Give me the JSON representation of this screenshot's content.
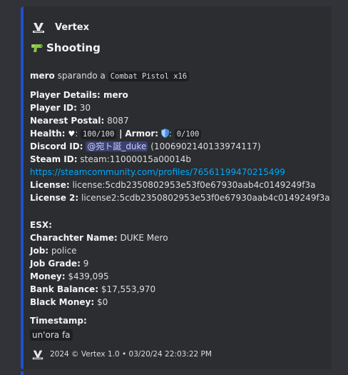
{
  "author": {
    "name": "Vertex"
  },
  "title": "Shooting",
  "intro": {
    "name": "mero",
    "text": "sparando a",
    "code": "Combat Pistol x16"
  },
  "player_details": {
    "heading": "Player Details: mero",
    "player_id_label": "Player ID:",
    "player_id": "30",
    "postal_label": "Nearest Postal:",
    "postal": "8087",
    "health_label": "Health:",
    "health": "100/100",
    "armor_label": "Armor:",
    "armor": "0/100",
    "separator": "|",
    "discord_label": "Discord ID:",
    "discord_mention": "@宛ト誕_duke",
    "discord_id": "(1006902140133974117)",
    "steam_label": "Steam ID:",
    "steam_id": "steam:11000015a00014b",
    "steam_link": "https://steamcommunity.com/profiles/76561199470215499",
    "license_label": "License:",
    "license": "license:5cdb2350802953e53f0e67930aab4c0149249f3a",
    "license2_label": "License 2:",
    "license2": "license2:5cdb2350802953e53f0e67930aab4c0149249f3a"
  },
  "esx": {
    "heading": "ESX:",
    "name_label": "Charachter Name:",
    "name": "DUKE Mero",
    "job_label": "Job:",
    "job": "police",
    "grade_label": "Job Grade:",
    "grade": "9",
    "money_label": "Money:",
    "money": "$439,095",
    "bank_label": "Bank Balance:",
    "bank": "$17,553,970",
    "black_label": "Black Money:",
    "black": "$0"
  },
  "timestamp": {
    "label": "Timestamp:",
    "value": "un'ora fa"
  },
  "footer": {
    "text": "2024 © Vertex 1.0 • 03/20/24 22:03:22 PM"
  },
  "colors": {
    "accent": "#1f4fd1",
    "link": "#00a8fc",
    "embed_bg": "#2b2d31",
    "page_bg": "#313338"
  },
  "icons": [
    "vertex-logo-icon",
    "gun-icon",
    "heart-icon",
    "shield-icon"
  ]
}
